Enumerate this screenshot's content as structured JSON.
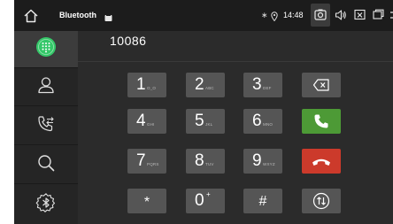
{
  "statusbar": {
    "title": "Bluetooth",
    "bluetooth_glyph": "∗",
    "time": "14:48",
    "icons": [
      "home-icon",
      "media-icon",
      "bluetooth-icon",
      "location-pin-icon",
      "camera-icon",
      "volume-icon",
      "close-app-icon",
      "window-icon",
      "back-icon"
    ]
  },
  "sidebar": {
    "items": [
      {
        "name": "dialpad",
        "icon": "dialpad-icon",
        "active": true
      },
      {
        "name": "contacts",
        "icon": "contact-person-icon",
        "active": false
      },
      {
        "name": "call-log",
        "icon": "call-log-icon",
        "active": false
      },
      {
        "name": "search",
        "icon": "search-icon",
        "active": false
      },
      {
        "name": "bluetooth-settings",
        "icon": "bluetooth-settings-icon",
        "active": false
      }
    ]
  },
  "dialer": {
    "number": "10086",
    "keys": [
      {
        "digit": "1",
        "letters": "O_O"
      },
      {
        "digit": "2",
        "letters": "ABC"
      },
      {
        "digit": "3",
        "letters": "DEF"
      },
      {
        "digit": "4",
        "letters": "GHI"
      },
      {
        "digit": "5",
        "letters": "JKL"
      },
      {
        "digit": "6",
        "letters": "MNO"
      },
      {
        "digit": "7",
        "letters": "PQRS"
      },
      {
        "digit": "8",
        "letters": "TUV"
      },
      {
        "digit": "9",
        "letters": "WXYZ"
      },
      {
        "digit": "*",
        "letters": ""
      },
      {
        "digit": "0",
        "letters": "+"
      },
      {
        "digit": "#",
        "letters": ""
      }
    ],
    "colors": {
      "call": "#4d9a36",
      "hangup": "#cc3a2b",
      "active_green": "#34c768"
    }
  }
}
